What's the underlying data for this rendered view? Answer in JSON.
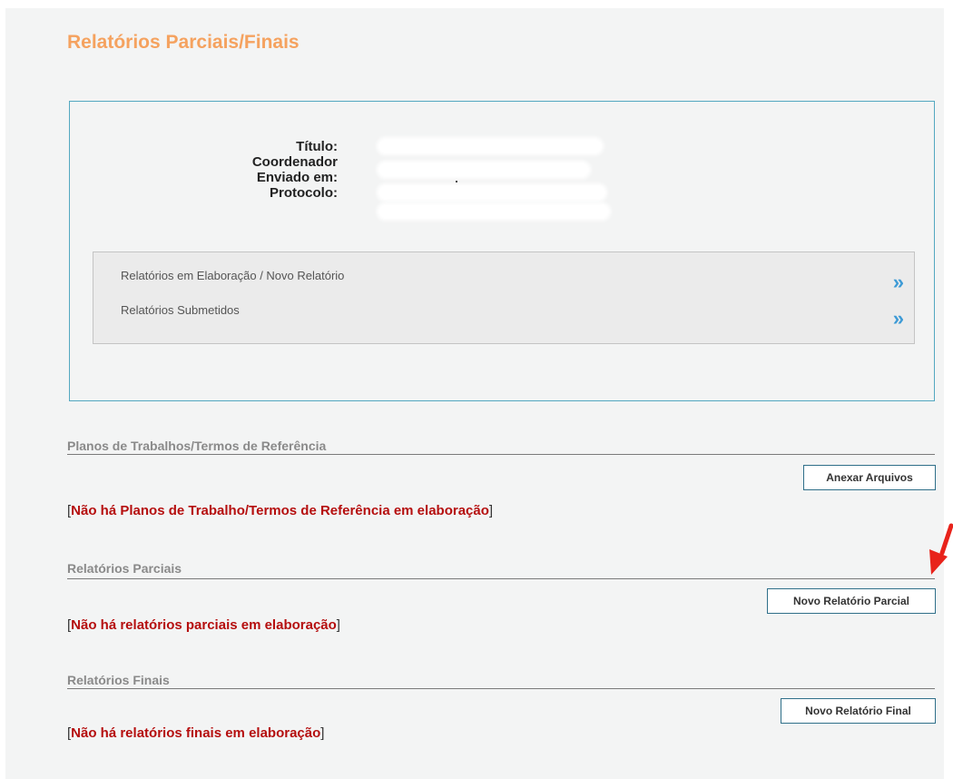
{
  "page_title": "Relatórios Parciais/Finais",
  "info": {
    "titulo_label": "Título:",
    "coordenador_label": "Coordenador",
    "enviado_label": "Enviado em:",
    "protocolo_label": "Protocolo:"
  },
  "nav": {
    "items": [
      {
        "label": "Relatórios em Elaboração / Novo Relatório",
        "icon": "double-chevron-right-icon"
      },
      {
        "label": "Relatórios Submetidos",
        "icon": "double-chevron-right-icon"
      }
    ],
    "chevron_glyph": "»"
  },
  "sections": {
    "planos": {
      "title": "Planos de Trabalhos/Termos de Referência",
      "button": "Anexar Arquivos",
      "message": "Não há Planos de Trabalho/Termos de Referência em elaboração"
    },
    "parciais": {
      "title": "Relatórios Parciais",
      "button": "Novo Relatório Parcial",
      "message": "Não há relatórios parciais em elaboração"
    },
    "finais": {
      "title": "Relatórios Finais",
      "button": "Novo Relatório Final",
      "message": "Não há relatórios finais em elaboração"
    }
  },
  "brackets": {
    "open": "[",
    "close": "]"
  },
  "colors": {
    "title_orange": "#f5a25f",
    "box_border": "#53a8c0",
    "chevron_blue": "#3e9bd6",
    "message_red": "#b50e0e",
    "annotation_arrow": "#e8231b"
  }
}
